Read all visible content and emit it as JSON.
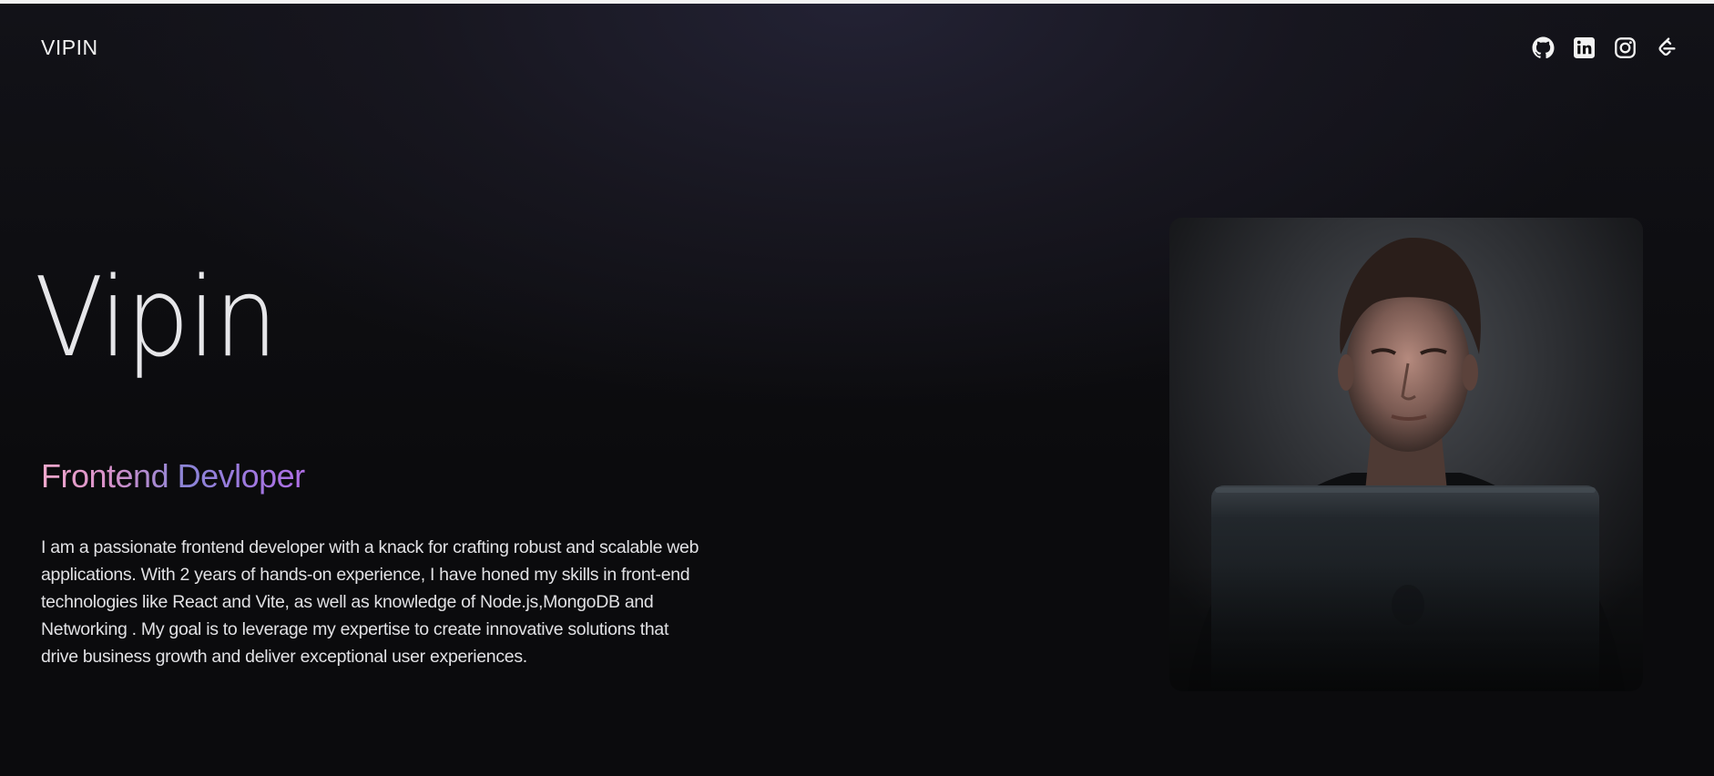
{
  "header": {
    "brand": "VIPIN",
    "social_links": [
      {
        "icon": "github-icon"
      },
      {
        "icon": "linkedin-icon"
      },
      {
        "icon": "instagram-icon"
      },
      {
        "icon": "leetcode-icon"
      }
    ]
  },
  "hero": {
    "name": "Vipin",
    "role": "Frontend Devloper",
    "bio": "I am a passionate frontend developer with a knack for crafting robust and scalable web applications. With 2 years of hands-on experience, I have honed my skills in front-end technologies like React and Vite, as well as knowledge of Node.js,MongoDB and Networking . My goal is to leverage my expertise to create innovative solutions that drive business growth and deliver exceptional user experiences."
  },
  "photo": {
    "subject": "person-at-laptop-photo"
  },
  "colors": {
    "background": "#0b0b0d",
    "role_gradient_start": "#f2a9cc",
    "role_gradient_end": "#b06ee6",
    "text": "#e1e1e4"
  }
}
